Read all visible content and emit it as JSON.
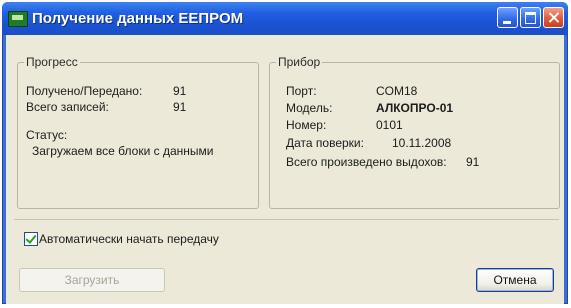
{
  "window": {
    "title": "Получение данных ЕЕПРОМ"
  },
  "progress": {
    "group_title": "Прогресс",
    "received_label": "Получено/Передано:",
    "received_value": "91",
    "total_label": "Всего записей:",
    "total_value": "91",
    "status_label": "Статус:",
    "status_text": "Загружаем все блоки с данными"
  },
  "device": {
    "group_title": "Прибор",
    "port_label": "Порт:",
    "port_value": "COM18",
    "model_label": "Модель:",
    "model_value": "АЛКОПРО-01",
    "number_label": "Номер:",
    "number_value": "0101",
    "verify_label": "Дата поверки:",
    "verify_value": "10.11.2008",
    "exhales_label": "Всего произведено выдохов:",
    "exhales_value": "91"
  },
  "auto_start": {
    "label": "Автоматически начать передачу",
    "checked": true
  },
  "buttons": {
    "load": "Загрузить",
    "cancel": "Отмена"
  },
  "colors": {
    "titlebar": "#1f5ee0",
    "client_bg": "#ece9d8",
    "close_button": "#e05a3a"
  }
}
